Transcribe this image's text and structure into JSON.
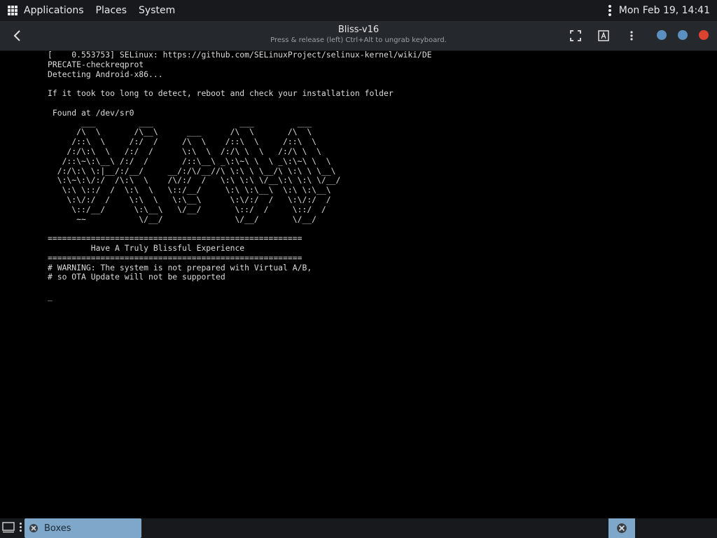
{
  "top_panel": {
    "menus": [
      "Applications",
      "Places",
      "System"
    ],
    "clock": "Mon Feb 19, 14:41"
  },
  "header": {
    "title": "Bliss-v16",
    "subtitle": "Press & release (left) Ctrl+Alt to ungrab keyboard."
  },
  "colors": {
    "panel_bg": "#17191c",
    "header_bg": "#25292e",
    "blue_button": "#5b8fbf",
    "red_button": "#d9432f",
    "task_active": "#7ea7c9"
  },
  "icons": [
    "apps-grid-icon",
    "kebab-menu-icon",
    "back-arrow-icon",
    "fullscreen-icon",
    "keyboard-icon",
    "boxes-icon",
    "show-desktop-icon"
  ],
  "console_lines": [
    "[    0.553753] SELinux: https://github.com/SELinuxProject/selinux-kernel/wiki/DE",
    "PRECATE-checkreqprot",
    "Detecting Android-x86...",
    "",
    "If it took too long to detect, reboot and check your installation folder",
    "",
    " Found at /dev/sr0",
    "       ___         ___                  ___         ___",
    "      /\\  \\       /\\__\\      ___      /\\  \\       /\\  \\",
    "     /::\\  \\     /:/  /     /\\  \\    /::\\  \\     /::\\  \\",
    "    /:/\\:\\  \\   /:/  /      \\:\\  \\  /:/\\ \\  \\   /:/\\ \\  \\",
    "   /::\\~\\:\\__\\ /:/  /       /::\\__\\ _\\:\\~\\ \\  \\ _\\:\\~\\ \\  \\",
    "  /:/\\:\\ \\:|__/:/__/     __/:/\\/__//\\ \\:\\ \\ \\__/\\ \\:\\ \\ \\__\\",
    "  \\:\\~\\:\\/:/  /\\:\\  \\    /\\/:/  /   \\:\\ \\:\\ \\/__\\:\\ \\:\\ \\/__/",
    "   \\:\\ \\::/  /  \\:\\  \\   \\::/__/     \\:\\ \\:\\__\\  \\:\\ \\:\\__\\",
    "    \\:\\/:/  /    \\:\\  \\   \\:\\__\\      \\:\\/:/  /   \\:\\/:/  /",
    "     \\::/__/      \\:\\__\\   \\/__/       \\::/  /     \\::/  /",
    "      ~~           \\/__/               \\/__/       \\/__/",
    "",
    "=====================================================",
    "         Have A Truly Blissful Experience",
    "=====================================================",
    "# WARNING: The system is not prepared with Virtual A/B,",
    "# so OTA Update will not be supported",
    "",
    "_"
  ],
  "taskbar": {
    "task_label": "Boxes"
  }
}
